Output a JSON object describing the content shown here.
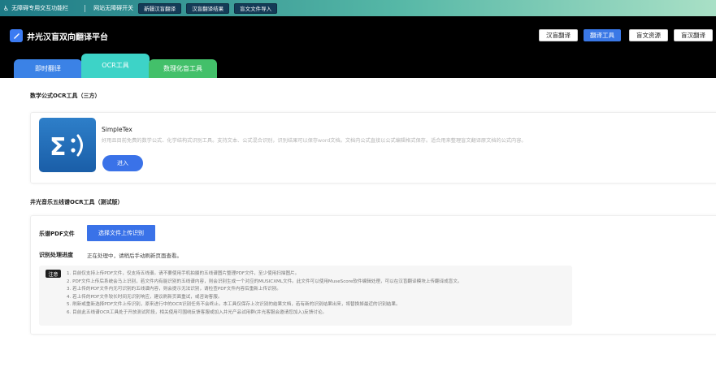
{
  "a11y_bar": {
    "title": "无障碍专用交互功能栏",
    "label": "网站无障碍开关",
    "buttons": [
      "新疆汉盲翻译",
      "汉盲翻译结果",
      "盲文文件导入"
    ]
  },
  "header": {
    "site_title": "井光汉盲双向翻译平台",
    "nav": [
      {
        "label": "汉盲翻译",
        "active": false
      },
      {
        "label": "翻译工具",
        "active": true
      },
      {
        "label": "盲文资源",
        "active": false
      },
      {
        "label": "盲汉翻译",
        "active": false
      }
    ]
  },
  "tabs": [
    {
      "label": "即时翻译",
      "color": "#3b82e6"
    },
    {
      "label": "OCR工具",
      "color": "#3dd3c7",
      "active": true
    },
    {
      "label": "数理化盲工具",
      "color": "#43c06a"
    }
  ],
  "math_section": {
    "title": "数学公式OCR工具（三方）",
    "app": {
      "name": "SimpleTex",
      "description": "好用且目前免费的数学公式、化学结构式识别工具。支持文本、公式混合识别，识别结果可以保存word文档。文档内公式直接以公式编辑格式保存。适合用来整理盲文翻译原文档的公式内容。",
      "button": "进入"
    }
  },
  "music_section": {
    "title": "井光音乐五线谱OCR工具（测试版）",
    "file_label": "乐谱PDF文件",
    "upload_button": "选择文件上传识别",
    "progress_label": "识别处理进度",
    "progress_text": "正在处理中，请稍后手动刷新页面查看。",
    "notice_badge": "注意",
    "notices": [
      "1. 目前仅支持上传PDF文件，仅支持五线谱。请不要使用手机拍摄的五线谱图片整理PDF文件，至少使用扫描图片。",
      "2. PDF文件上传后系统会马上识别，若文件内有能识别的五线谱内容，则会识别生成一个对应的MUSICXML文件。此文件可以使用MuseScore软件编辑处理，可以在汉盲翻译模块上传翻译成盲文。",
      "3. 若上传的PDF文件内无可识别的五线谱内容，则会提示无法识别，请检查PDF文件内容后重新上传识别。",
      "4. 若上传的PDF文件较长时间无识别响应，建议刷新页面重试，或咨询客服。",
      "5. 刷新或重新选择PDF文件上传识别，原来进行中的OCR识别任务不会终止。本工具仅保存上次识别的结果文档，若有新的识别结果出来，将替换掉最近的识别结果。",
      "6. 目前此五线谱OCR工具处于开放测试阶段，相关使用可围绕反馈客服或加入井光产品试用群(井光客服会邀请您加入)反馈讨论。"
    ]
  },
  "colors": {
    "accent": "#3a72e8",
    "header_bg": "#000000",
    "a11y_bar_gradient": [
      "#1e7a86",
      "#a9e0c6"
    ]
  }
}
